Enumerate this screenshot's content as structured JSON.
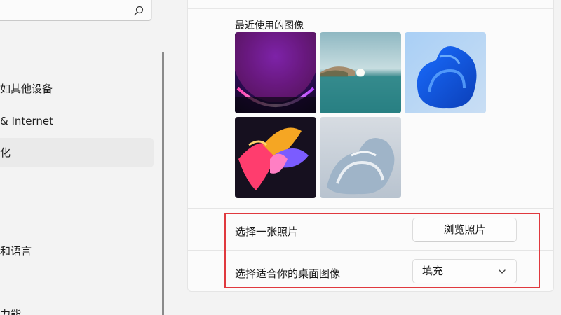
{
  "sidebar": {
    "items": [
      {
        "label": "如其他设备"
      },
      {
        "label": "& Internet"
      },
      {
        "label": "化"
      },
      {
        "label": "和语言"
      },
      {
        "label": "力能"
      }
    ],
    "active_index": 2
  },
  "background": {
    "recent_title": "最近使用的图像",
    "recent_images": [
      {
        "name": "purple-glow-wallpaper"
      },
      {
        "name": "lake-sunrise-wallpaper"
      },
      {
        "name": "blue-bloom-wallpaper"
      },
      {
        "name": "colorful-ribbon-wallpaper"
      },
      {
        "name": "light-bloom-wallpaper"
      }
    ],
    "choose_photo_label": "选择一张照片",
    "browse_button_label": "浏览照片",
    "fit_label": "选择适合你的桌面图像",
    "fit_selected": "填充"
  },
  "colors": {
    "highlight": "#e0393e",
    "card_bg": "#fbfbfb",
    "page_bg": "#f3f3f3"
  }
}
